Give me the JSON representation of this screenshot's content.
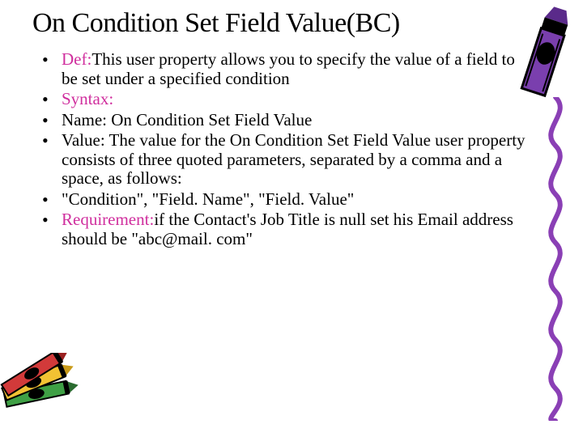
{
  "title": "On Condition Set Field Value(BC)",
  "bullets": [
    {
      "label": "Def:",
      "text": "This user property allows you to specify the value of a field to be set under a specified condition"
    },
    {
      "label": "Syntax:",
      "text": ""
    },
    {
      "label": "",
      "text": "Name: On Condition Set Field Value"
    },
    {
      "label": "",
      "text": "Value: The value for the On Condition Set Field Value user property consists of three quoted parameters, separated by a comma and a space, as follows:"
    },
    {
      "label": "",
      "text": "\"Condition\", \"Field. Name\", \"Field. Value\""
    },
    {
      "label": "Requirement:",
      "text": "if the Contact's Job Title is null set his Email address should be \"abc@mail. com\""
    }
  ],
  "decor": {
    "crayon_top": "crayon-icon",
    "crayon_bottom": "crayons-icon",
    "squiggle": "purple-squiggle"
  }
}
